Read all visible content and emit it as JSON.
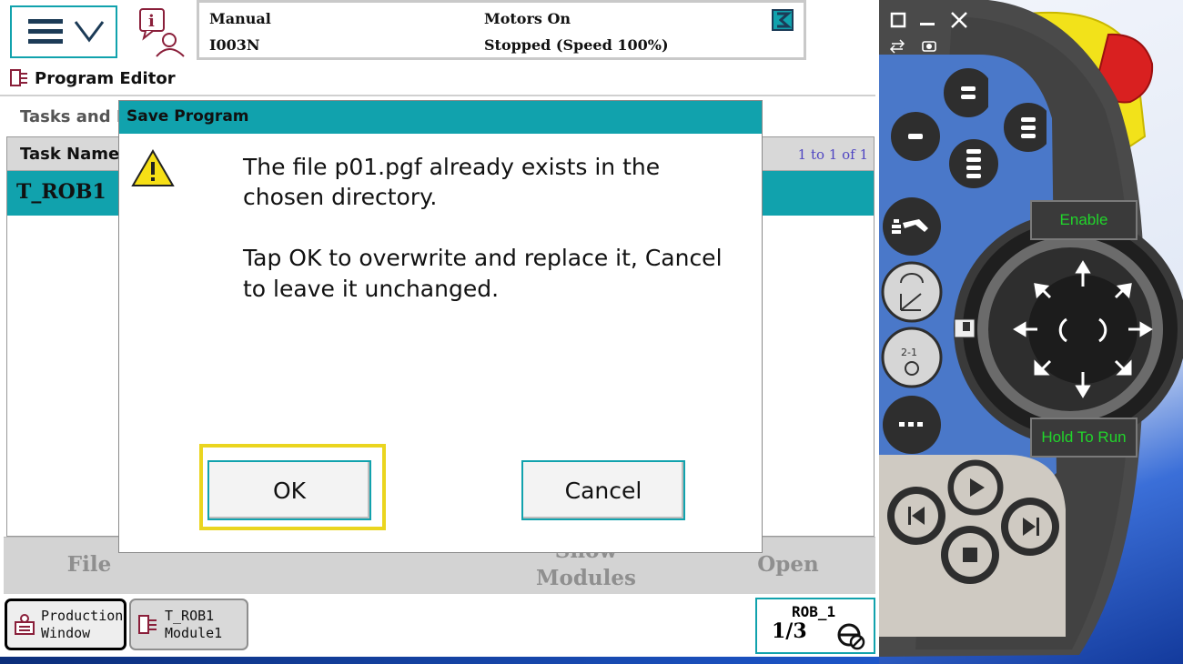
{
  "status": {
    "mode": "Manual",
    "system": "I003N",
    "motors": "Motors On",
    "state": "Stopped (Speed 100%)"
  },
  "window": {
    "title": "Program Editor"
  },
  "tasks": {
    "section_label": "Tasks and Programs",
    "column_task": "Task Name",
    "paging": "1 to 1 of 1",
    "rows": [
      {
        "task": "T_ROB1"
      }
    ]
  },
  "commands": {
    "file": "File",
    "show_modules": "Show Modules",
    "open": "Open"
  },
  "dialog": {
    "title": "Save Program",
    "message_line1": "The file p01.pgf already exists in the",
    "message_line2": "chosen directory.",
    "message_line3": "Tap OK to overwrite and replace it, Cancel",
    "message_line4": "to leave it unchanged.",
    "ok": "OK",
    "cancel": "Cancel"
  },
  "taskbar": {
    "production": "Production\nWindow",
    "module": "T_ROB1\nModule1"
  },
  "robot": {
    "name": "ROB_1",
    "fraction": "1/3"
  },
  "pendant": {
    "enable": "Enable",
    "hold_to_run": "Hold To Run"
  },
  "colors": {
    "accent": "#11a2ad",
    "highlight": "#ead51f",
    "pendant_body": "#4a4a4a",
    "pendant_panel": "#4a78c9",
    "emergency_stop": "#d92020",
    "enable_text": "#21d52b"
  }
}
